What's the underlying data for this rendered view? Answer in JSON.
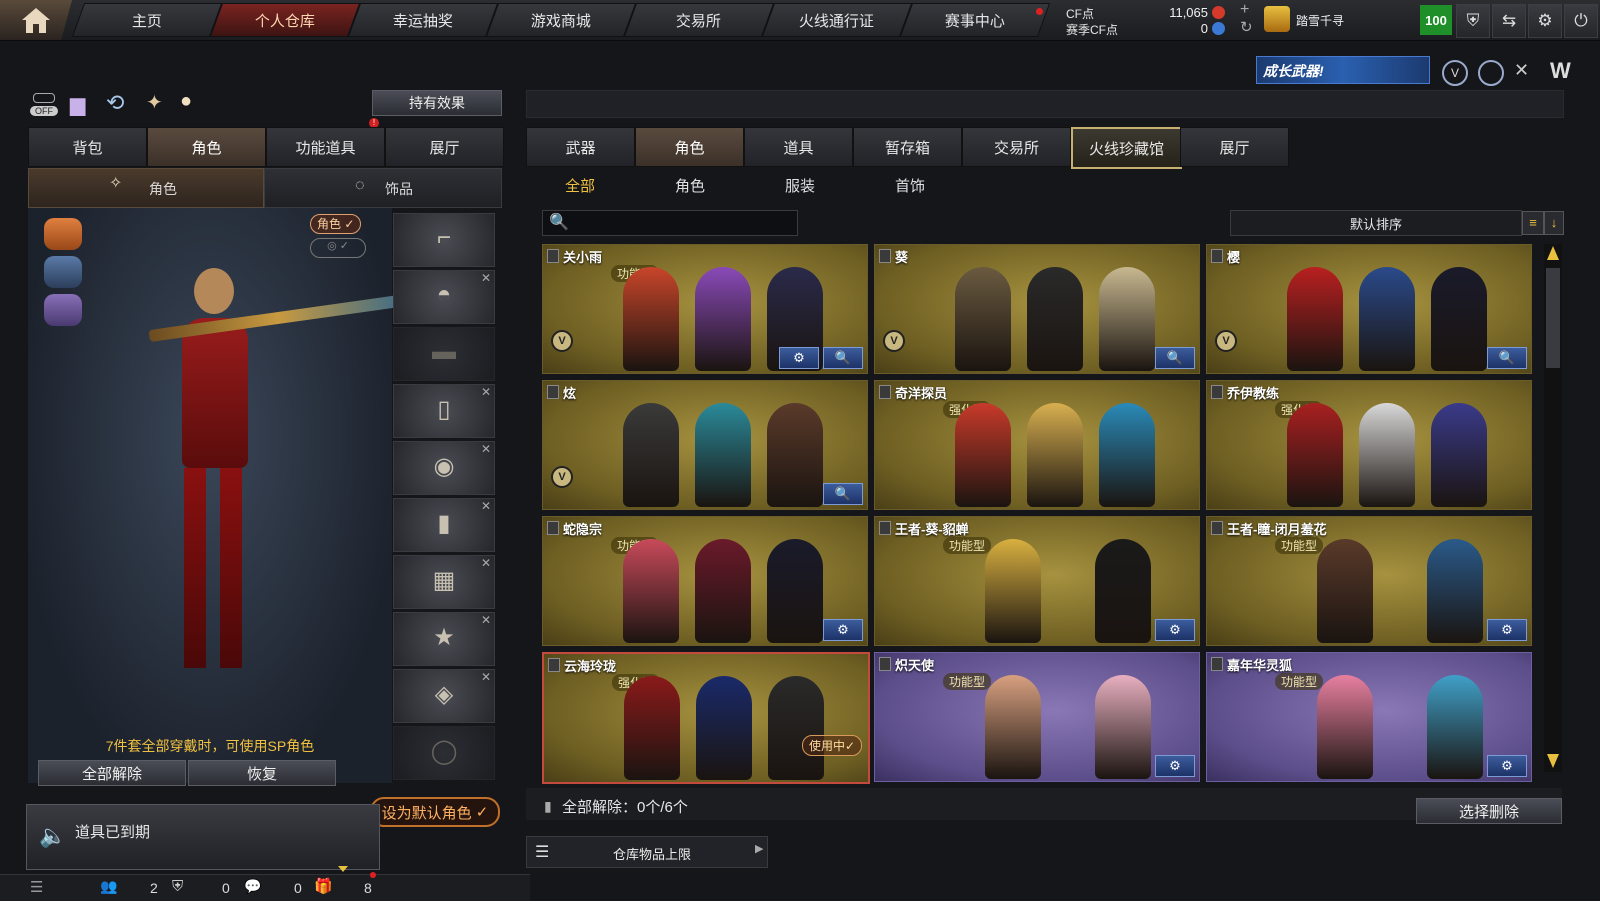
{
  "nav": {
    "tabs": [
      "主页",
      "个人仓库",
      "幸运抽奖",
      "游戏商城",
      "交易所",
      "火线通行证",
      "赛事中心"
    ],
    "active_index": 1
  },
  "currency": {
    "cf_label": "CF点",
    "cf_value": "11,065",
    "season_cf_label": "赛季CF点",
    "season_cf_value": "0",
    "username": "踏雪千寻",
    "level": "100"
  },
  "banner": {
    "promo_text": "成长武器!"
  },
  "left_panel": {
    "hold_effect_button": "持有效果",
    "off_label": "OFF",
    "tabs": [
      "背包",
      "角色",
      "功能道具",
      "展厅"
    ],
    "active_tab": 1,
    "subtabs": [
      "角色",
      "饰品"
    ],
    "role_toggle_label": "角色",
    "set_bonus_text": "7件套全部穿戴时，可使用SP角色",
    "unequip_all_button": "全部解除",
    "restore_button": "恢复",
    "set_default_button": "设为默认角色"
  },
  "notification": {
    "text": "道具已到期"
  },
  "status_bar": {
    "count1": "2",
    "count2": "0",
    "count3": "0",
    "count4": "8"
  },
  "right_panel": {
    "tabs": [
      "武器",
      "角色",
      "道具",
      "暂存箱",
      "交易所",
      "火线珍藏馆",
      "展厅"
    ],
    "active_tab": 1,
    "highlight_tab": 5,
    "subtabs": [
      "全部",
      "角色",
      "服装",
      "首饰"
    ],
    "active_subtab": 0,
    "search_placeholder": "",
    "sort_label": "默认排序",
    "cards": [
      {
        "name": "关小雨",
        "badge": "功能型",
        "v": true,
        "gear": true,
        "search": true,
        "purple": false,
        "selected": false,
        "in_use": ""
      },
      {
        "name": "葵",
        "badge": "",
        "v": true,
        "gear": false,
        "search": true,
        "purple": false,
        "selected": false,
        "in_use": ""
      },
      {
        "name": "樱",
        "badge": "",
        "v": true,
        "gear": false,
        "search": true,
        "purple": false,
        "selected": false,
        "in_use": ""
      },
      {
        "name": "炫",
        "badge": "",
        "v": true,
        "gear": false,
        "search": true,
        "purple": false,
        "selected": false,
        "in_use": ""
      },
      {
        "name": "奇洋探员",
        "badge": "强化型",
        "v": false,
        "gear": false,
        "search": false,
        "purple": false,
        "selected": false,
        "in_use": ""
      },
      {
        "name": "乔伊教练",
        "badge": "强化型",
        "v": false,
        "gear": false,
        "search": false,
        "purple": false,
        "selected": false,
        "in_use": ""
      },
      {
        "name": "蛇隐宗",
        "badge": "功能型",
        "v": false,
        "gear": true,
        "search": false,
        "purple": false,
        "selected": false,
        "in_use": ""
      },
      {
        "name": "王者-葵-貂蝉",
        "badge": "功能型",
        "v": false,
        "gear": true,
        "search": false,
        "purple": false,
        "selected": false,
        "in_use": ""
      },
      {
        "name": "王者-瞳-闭月羞花",
        "badge": "功能型",
        "v": false,
        "gear": true,
        "search": false,
        "purple": false,
        "selected": false,
        "in_use": ""
      },
      {
        "name": "云海玲珑",
        "badge": "强化型",
        "v": false,
        "gear": false,
        "search": false,
        "purple": false,
        "selected": true,
        "in_use": "使用中✓"
      },
      {
        "name": "炽天使",
        "badge": "功能型",
        "v": false,
        "gear": true,
        "search": false,
        "purple": true,
        "selected": false,
        "in_use": ""
      },
      {
        "name": "嘉年华灵狐",
        "badge": "功能型",
        "v": false,
        "gear": true,
        "search": false,
        "purple": true,
        "selected": false,
        "in_use": ""
      }
    ],
    "unequip_status": "全部解除：0个/6个",
    "delete_button": "选择删除",
    "storage_limit": "仓库物品上限"
  },
  "colors": {
    "gold_card": "#8f7d34",
    "purple_card": "#6c5a9a",
    "active_tab": "#5a4a3e",
    "nav_active": "#7a2420",
    "accent_green": "#1f8f2a"
  }
}
